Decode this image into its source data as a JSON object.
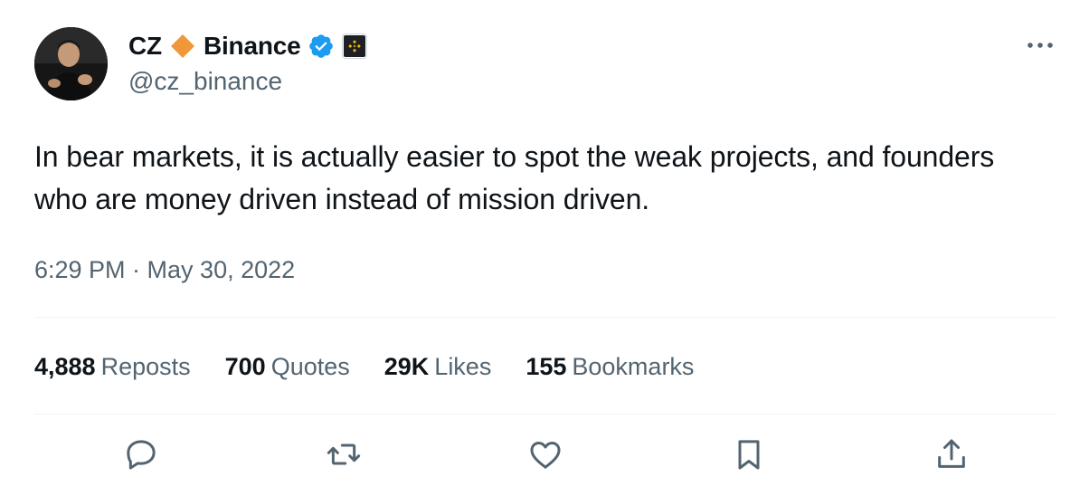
{
  "author": {
    "name_part1": "CZ",
    "name_part2": "Binance",
    "handle": "@cz_binance",
    "badge_verified_color": "#1d9bf0",
    "diamond_color": "#f0973a",
    "affiliate_color": "#f0b90b"
  },
  "tweet": {
    "text": "In bear markets, it is actually easier to spot the weak projects, and founders who are money driven instead of mission driven.",
    "timestamp": "6:29 PM · May 30, 2022"
  },
  "stats": [
    {
      "value": "4,888",
      "label": "Reposts"
    },
    {
      "value": "700",
      "label": "Quotes"
    },
    {
      "value": "29K",
      "label": "Likes"
    },
    {
      "value": "155",
      "label": "Bookmarks"
    }
  ],
  "actions": [
    "reply-icon",
    "repost-icon",
    "like-icon",
    "bookmark-icon",
    "share-icon"
  ],
  "colors": {
    "text_primary": "#0f1419",
    "text_secondary": "#536471",
    "divider": "#eff3f4"
  }
}
